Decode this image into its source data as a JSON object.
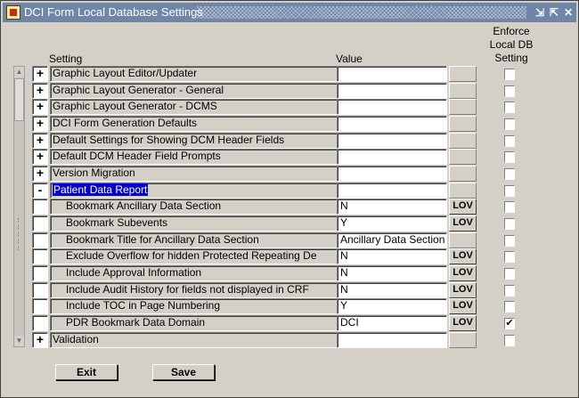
{
  "window": {
    "title": "DCI Form Local Database Settings"
  },
  "headers": {
    "setting": "Setting",
    "value": "Value",
    "enforce": "Enforce\nLocal DB\nSetting"
  },
  "rows": [
    {
      "toggle": "+",
      "label": "Graphic Layout Editor/Updater",
      "value": "",
      "lov": "",
      "checked": ""
    },
    {
      "toggle": "+",
      "label": "Graphic Layout Generator - General",
      "value": "",
      "lov": "",
      "checked": ""
    },
    {
      "toggle": "+",
      "label": "Graphic Layout Generator - DCMS",
      "value": "",
      "lov": "",
      "checked": ""
    },
    {
      "toggle": "+",
      "label": "DCI Form Generation Defaults",
      "value": "",
      "lov": "",
      "checked": ""
    },
    {
      "toggle": "+",
      "label": "Default Settings for Showing DCM Header Fields",
      "value": "",
      "lov": "",
      "checked": ""
    },
    {
      "toggle": "+",
      "label": "Default DCM Header Field Prompts",
      "value": "",
      "lov": "",
      "checked": ""
    },
    {
      "toggle": "+",
      "label": "Version Migration",
      "value": "",
      "lov": "",
      "checked": ""
    },
    {
      "toggle": "-",
      "label": "Patient Data Report",
      "value": "",
      "lov": "",
      "checked": ""
    },
    {
      "toggle": "",
      "label": "Bookmark Ancillary Data Section",
      "value": "N",
      "lov": "LOV",
      "checked": ""
    },
    {
      "toggle": "",
      "label": "Bookmark Subevents",
      "value": "Y",
      "lov": "LOV",
      "checked": ""
    },
    {
      "toggle": "",
      "label": "Bookmark Title for Ancillary Data Section",
      "value": "Ancillary Data Section",
      "lov": "",
      "checked": ""
    },
    {
      "toggle": "",
      "label": "Exclude Overflow for hidden Protected Repeating De",
      "value": "N",
      "lov": "LOV",
      "checked": ""
    },
    {
      "toggle": "",
      "label": "Include Approval Information",
      "value": "N",
      "lov": "LOV",
      "checked": ""
    },
    {
      "toggle": "",
      "label": "Include Audit History for fields not displayed in CRF",
      "value": "N",
      "lov": "LOV",
      "checked": ""
    },
    {
      "toggle": "",
      "label": "Include TOC in Page Numbering",
      "value": "Y",
      "lov": "LOV",
      "checked": ""
    },
    {
      "toggle": "",
      "label": "PDR Bookmark Data Domain",
      "value": "DCI",
      "lov": "LOV",
      "checked": "✔"
    },
    {
      "toggle": "+",
      "label": "Validation",
      "value": "",
      "lov": "",
      "checked": ""
    }
  ],
  "buttons": {
    "exit": "Exit",
    "save": "Save"
  }
}
